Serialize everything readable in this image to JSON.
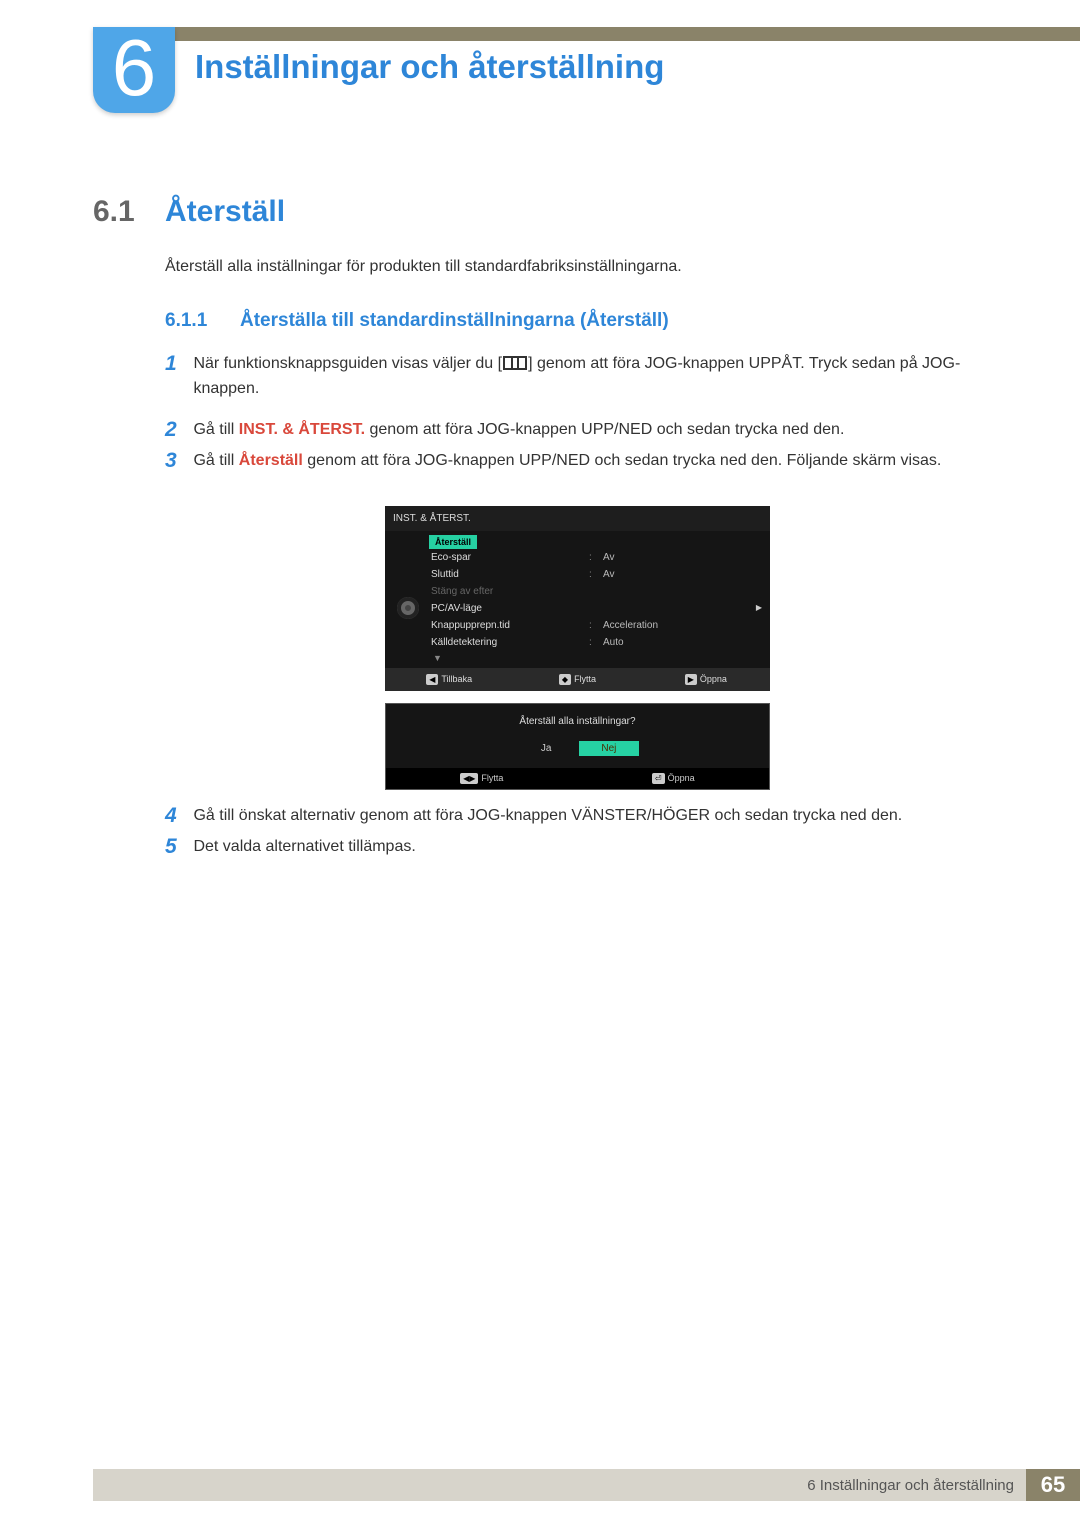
{
  "chapter": {
    "number": "6",
    "title": "Inställningar och återställning"
  },
  "section": {
    "number": "6.1",
    "title": "Återställ",
    "intro": "Återställ alla inställningar för produkten till standardfabriksinställningarna."
  },
  "subsection": {
    "number": "6.1.1",
    "title": "Återställa till standardinställningarna (Återställ)"
  },
  "steps": {
    "s1": {
      "num": "1",
      "pre": "När funktionsknappsguiden visas väljer du [",
      "post": "] genom att föra JOG-knappen UPPÅT. Tryck sedan på JOG-knappen."
    },
    "s2": {
      "num": "2",
      "pre": "Gå till ",
      "bold": "INST. & ÅTERST.",
      "post": " genom att föra JOG-knappen UPP/NED och sedan trycka ned den."
    },
    "s3": {
      "num": "3",
      "pre": "Gå till ",
      "bold": "Återställ",
      "post": " genom att föra JOG-knappen UPP/NED och sedan trycka ned den. Följande skärm visas."
    },
    "s4": {
      "num": "4",
      "text": "Gå till önskat alternativ genom att föra JOG-knappen VÄNSTER/HÖGER och sedan trycka ned den."
    },
    "s5": {
      "num": "5",
      "text": "Det valda alternativet tillämpas."
    }
  },
  "osd": {
    "title": "INST. & ÅTERST.",
    "highlight": "Återställ",
    "rows": [
      {
        "label": "Eco-spar",
        "value": "Av",
        "dim": false
      },
      {
        "label": "Sluttid",
        "value": "Av",
        "dim": false
      },
      {
        "label": "Stäng av efter",
        "value": "",
        "dim": true
      },
      {
        "label": "PC/AV-läge",
        "value": "",
        "dim": false,
        "arrow": true
      },
      {
        "label": "Knappupprepn.tid",
        "value": "Acceleration",
        "dim": false
      },
      {
        "label": "Källdetektering",
        "value": "Auto",
        "dim": false
      }
    ],
    "footer": {
      "back": "Tillbaka",
      "move": "Flytta",
      "open": "Öppna"
    }
  },
  "dialog": {
    "question": "Återställ alla inställningar?",
    "yes": "Ja",
    "no": "Nej",
    "footer": {
      "move": "Flytta",
      "open": "Öppna"
    }
  },
  "pagefooter": {
    "text": "6 Inställningar och återställning",
    "number": "65"
  }
}
